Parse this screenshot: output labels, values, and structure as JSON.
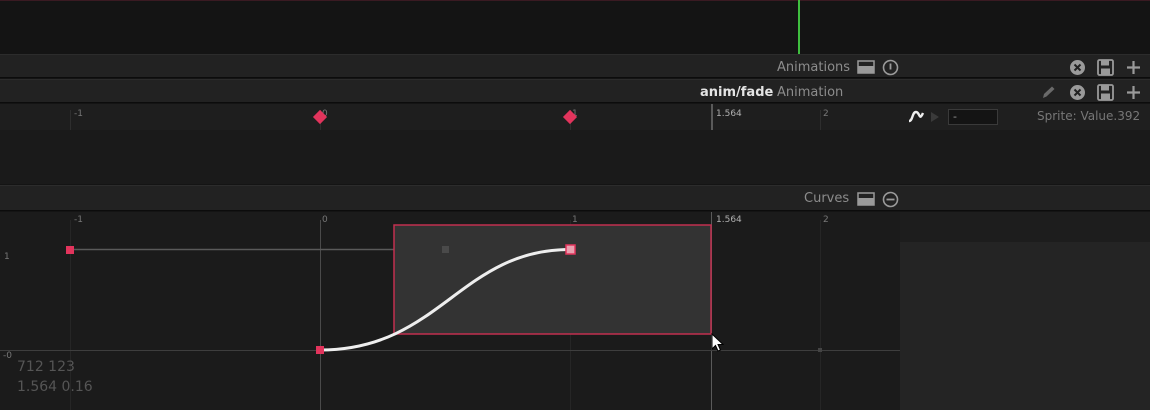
{
  "colors": {
    "accent": "#e2345c",
    "playhead": "#3fbf3f",
    "curve": "#eeeeee"
  },
  "panels": {
    "animations": {
      "title": "Animations"
    },
    "animation": {
      "name": "anim/fade",
      "title": "Animation"
    },
    "curves": {
      "title": "Curves"
    }
  },
  "timeline": {
    "ticks": [
      "-1",
      "0",
      "1",
      "2"
    ],
    "end_marker": "1.564",
    "property": "Sprite: Value.392",
    "curve_input": "-"
  },
  "curves_view": {
    "ticks_x": [
      "-1",
      "0",
      "1",
      "2"
    ],
    "end_marker": "1.564",
    "ticks_y": [
      "1",
      "-0"
    ],
    "cursor_px": "712 123",
    "cursor_val": "1.564 0.16"
  }
}
